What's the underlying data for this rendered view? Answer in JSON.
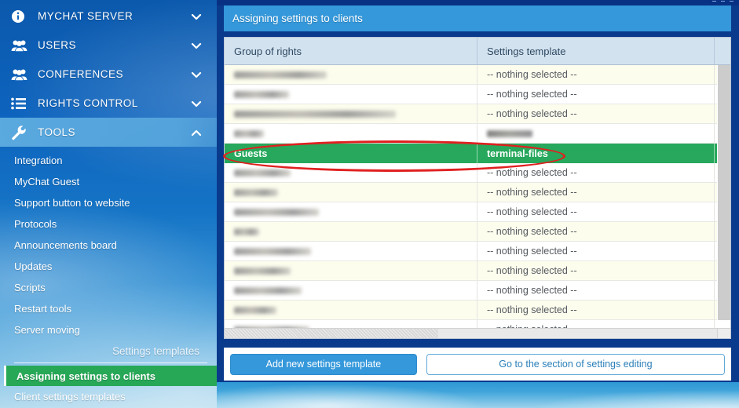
{
  "app": {
    "window_controls": [
      "minimize",
      "maximize",
      "close"
    ]
  },
  "sidebar": {
    "nav": [
      {
        "label": "MYCHAT SERVER",
        "icon": "info-circle-icon",
        "chevron": "chevron-down-icon",
        "expanded": false
      },
      {
        "label": "USERS",
        "icon": "users-group-icon",
        "chevron": "chevron-down-icon",
        "expanded": false
      },
      {
        "label": "CONFERENCES",
        "icon": "users-group-icon",
        "chevron": "chevron-down-icon",
        "expanded": false
      },
      {
        "label": "RIGHTS CONTROL",
        "icon": "list-icon",
        "chevron": "chevron-down-icon",
        "expanded": false
      },
      {
        "label": "TOOLS",
        "icon": "wrench-icon",
        "chevron": "chevron-up-icon",
        "expanded": true
      }
    ],
    "sub_items": [
      {
        "label": "Integration"
      },
      {
        "label": "MyChat Guest"
      },
      {
        "label": "Support button to website"
      },
      {
        "label": "Protocols"
      },
      {
        "label": "Announcements board"
      },
      {
        "label": "Updates"
      },
      {
        "label": "Scripts"
      },
      {
        "label": "Restart tools"
      },
      {
        "label": "Server moving"
      }
    ],
    "section_label": "Settings templates",
    "section_items": [
      {
        "label": "Assigning settings to clients",
        "selected": true
      },
      {
        "label": "Client settings templates",
        "selected": false
      }
    ],
    "selected_color": "#27a857"
  },
  "header": {
    "title": "Assigning settings to clients",
    "bg_color": "#3498db"
  },
  "table": {
    "columns": [
      "Group of rights",
      "Settings template",
      ""
    ],
    "nothing_selected_text": "-- nothing selected --",
    "rows": [
      {
        "group": "",
        "group_blurred": true,
        "group_blur_width": 118,
        "template": "-- nothing selected --",
        "template_blurred": false,
        "selected": false,
        "alt": true
      },
      {
        "group": "",
        "group_blurred": true,
        "group_blur_width": 70,
        "template": "-- nothing selected --",
        "template_blurred": false,
        "selected": false,
        "alt": false
      },
      {
        "group": "",
        "group_blurred": true,
        "group_blur_width": 206,
        "template": "-- nothing selected --",
        "template_blurred": false,
        "selected": false,
        "alt": true
      },
      {
        "group": "",
        "group_blurred": true,
        "group_blur_width": 38,
        "template": "",
        "template_blurred": true,
        "template_blur_width": 58,
        "selected": false,
        "alt": false
      },
      {
        "group": "Guests",
        "group_blurred": false,
        "template": "terminal-files",
        "template_blurred": false,
        "selected": true,
        "alt": false
      },
      {
        "group": "",
        "group_blurred": true,
        "group_blur_width": 72,
        "template": "-- nothing selected --",
        "template_blurred": false,
        "selected": false,
        "alt": false
      },
      {
        "group": "",
        "group_blurred": true,
        "group_blur_width": 56,
        "template": "-- nothing selected --",
        "template_blurred": false,
        "selected": false,
        "alt": true
      },
      {
        "group": "",
        "group_blurred": true,
        "group_blur_width": 108,
        "template": "-- nothing selected --",
        "template_blurred": false,
        "selected": false,
        "alt": false
      },
      {
        "group": "",
        "group_blurred": true,
        "group_blur_width": 32,
        "template": "-- nothing selected --",
        "template_blurred": false,
        "selected": false,
        "alt": true
      },
      {
        "group": "",
        "group_blurred": true,
        "group_blur_width": 98,
        "template": "-- nothing selected --",
        "template_blurred": false,
        "selected": false,
        "alt": false
      },
      {
        "group": "",
        "group_blurred": true,
        "group_blur_width": 72,
        "template": "-- nothing selected --",
        "template_blurred": false,
        "selected": false,
        "alt": true
      },
      {
        "group": "",
        "group_blurred": true,
        "group_blur_width": 86,
        "template": "-- nothing selected --",
        "template_blurred": false,
        "selected": false,
        "alt": false
      },
      {
        "group": "",
        "group_blurred": true,
        "group_blur_width": 54,
        "template": "-- nothing selected --",
        "template_blurred": false,
        "selected": false,
        "alt": true
      },
      {
        "group": "",
        "group_blurred": true,
        "group_blur_width": 96,
        "template": "-- nothing selected --",
        "template_blurred": false,
        "selected": false,
        "alt": false
      }
    ],
    "selected_row_color": "#27a85c",
    "header_bg": "#d3e2ef"
  },
  "annotation": {
    "shape": "ellipse",
    "color": "#e02020",
    "target": "Guests / terminal-files row"
  },
  "buttons": {
    "add_template": "Add new settings template",
    "go_to_editing": "Go to the section of settings editing"
  }
}
